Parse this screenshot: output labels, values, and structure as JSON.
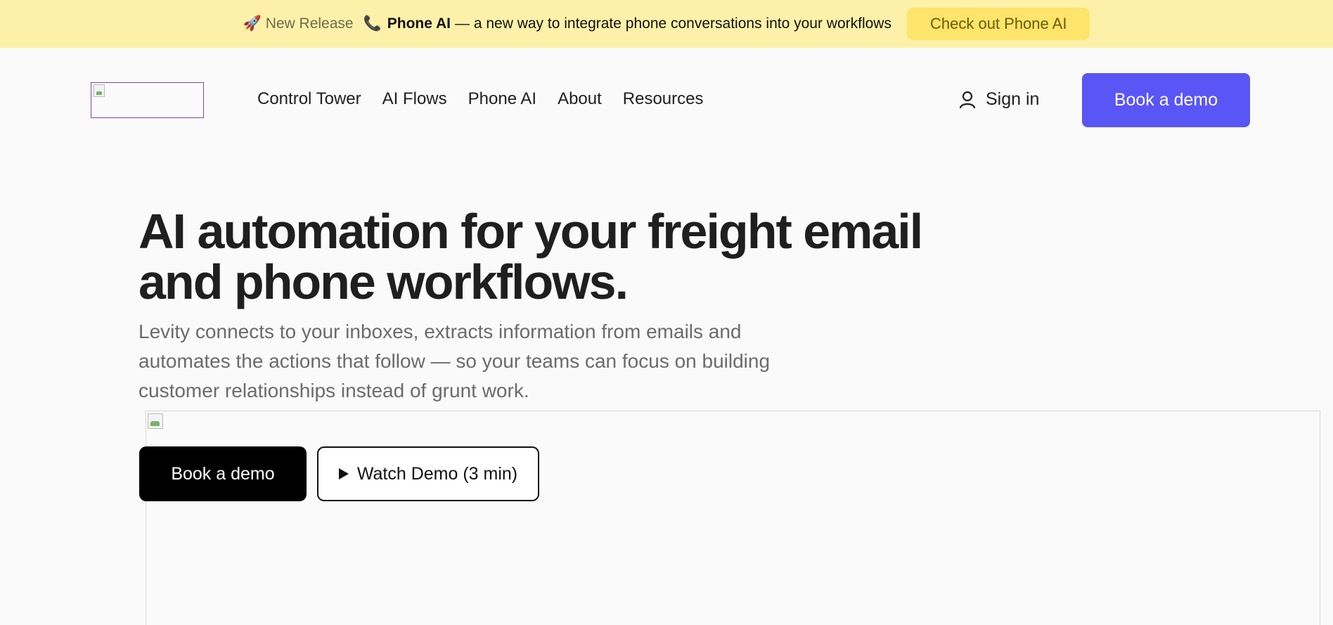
{
  "announcement": {
    "icon": "rocket-icon",
    "tag": "New Release",
    "phone_icon": "phone-icon",
    "product": "Phone AI",
    "message": "— a new way to integrate phone conversations into your workflows",
    "cta": "Check out Phone AI"
  },
  "nav": {
    "items": [
      {
        "label": "Control Tower"
      },
      {
        "label": "AI Flows"
      },
      {
        "label": "Phone AI"
      },
      {
        "label": "About"
      },
      {
        "label": "Resources"
      }
    ],
    "sign_in": "Sign in",
    "book_demo": "Book a demo"
  },
  "hero": {
    "title": "AI automation for your freight email and phone workflows.",
    "subtitle": "Levity connects to your inboxes, extracts information from emails and automates the actions that follow — so your teams can focus on building customer relationships instead of grunt work.",
    "primary_cta": "Book a demo",
    "secondary_cta": "Watch Demo (3 min)"
  },
  "colors": {
    "announcement_bg": "#fdf1a9",
    "accent": "#5a55f5",
    "cta_yellow": "#fde46a"
  }
}
